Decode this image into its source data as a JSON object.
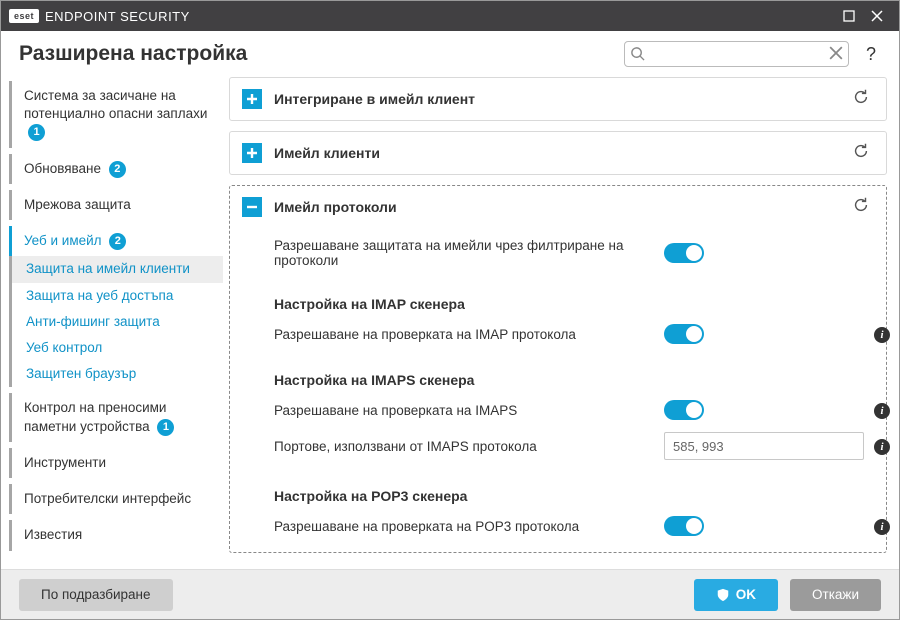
{
  "titlebar": {
    "brand_tag": "eset",
    "brand_text": "ENDPOINT SECURITY"
  },
  "header": {
    "title": "Разширена настройка",
    "search_placeholder": ""
  },
  "sidebar": {
    "items": [
      {
        "label": "Система за засичане на потенциално опасни заплахи",
        "badge": "1",
        "group": true
      },
      {
        "label": "Обновяване",
        "badge": "2",
        "group": true
      },
      {
        "label": "Мрежова защита",
        "group": true
      },
      {
        "label": "Уеб и имейл",
        "badge": "2",
        "group": true,
        "active": true
      },
      {
        "label": "Защита на имейл клиенти",
        "sub": true,
        "selected": true
      },
      {
        "label": "Защита на уеб достъпа",
        "sub": true
      },
      {
        "label": "Анти-фишинг защита",
        "sub": true
      },
      {
        "label": "Уеб контрол",
        "sub": true
      },
      {
        "label": "Защитен браузър",
        "sub": true
      },
      {
        "label": "Контрол на преносими паметни устройства",
        "badge": "1",
        "group": true
      },
      {
        "label": "Инструменти",
        "group": true
      },
      {
        "label": "Потребителски интерфейс",
        "group": true
      },
      {
        "label": "Известия",
        "group": true
      }
    ]
  },
  "panels": {
    "p1": {
      "title": "Интегриране в имейл клиент"
    },
    "p2": {
      "title": "Имейл клиенти"
    },
    "p3": {
      "title": "Имейл протоколи",
      "rows": {
        "enable_filter": "Разрешаване защитата на имейли чрез филтриране на протоколи",
        "imap_heading": "Настройка на IMAP скенера",
        "imap_enable": "Разрешаване на проверката на IMAP протокола",
        "imaps_heading": "Настройка на IMAPS скенера",
        "imaps_enable": "Разрешаване на проверката на IMAPS",
        "imaps_ports_label": "Портове, използвани от IMAPS протокола",
        "imaps_ports_value": "585, 993",
        "pop3_heading": "Настройка на POP3 скенера",
        "pop3_enable": "Разрешаване на проверката на POP3 протокола"
      }
    }
  },
  "footer": {
    "default_btn": "По подразбиране",
    "ok_btn": "OK",
    "cancel_btn": "Откажи"
  }
}
